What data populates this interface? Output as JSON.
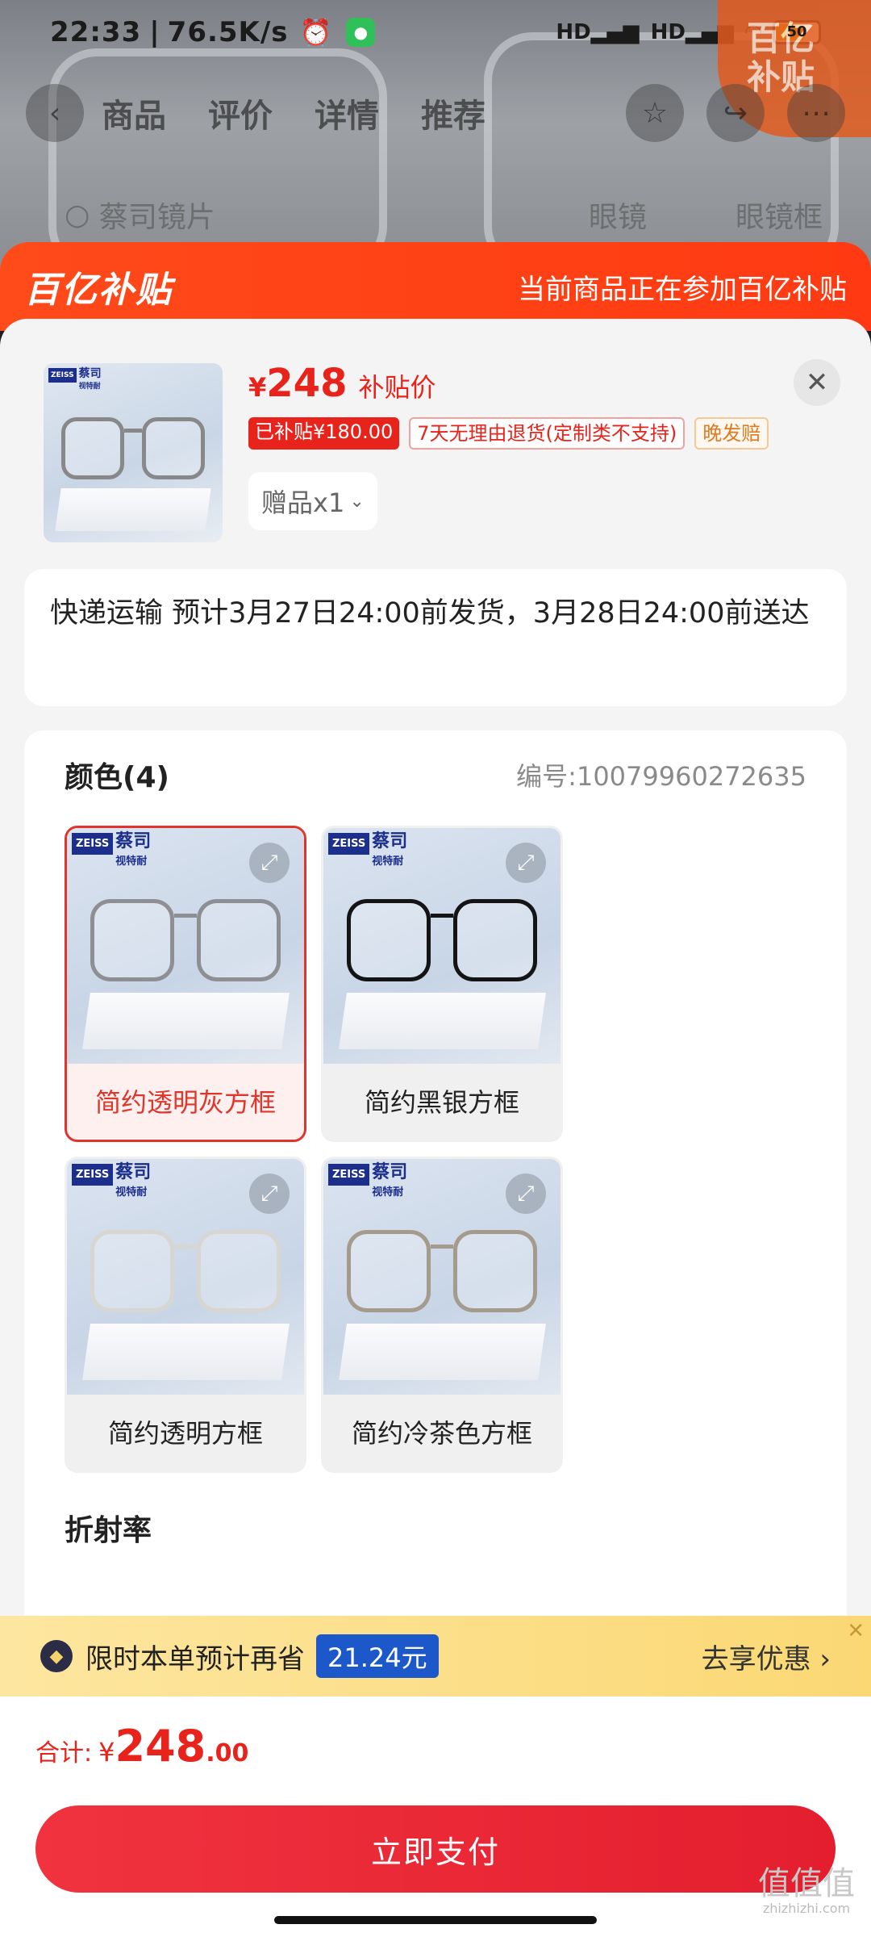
{
  "status_bar": {
    "time": "22:33",
    "speed": "76.5K/s",
    "hd1": "HD",
    "hd2": "HD",
    "battery": "50"
  },
  "product_nav": {
    "tabs": [
      "商品",
      "评价",
      "详情",
      "推荐"
    ],
    "search": "蔡司镜片",
    "sub_tabs": [
      "眼镜",
      "眼镜框"
    ]
  },
  "corner_badge": {
    "line1": "百亿",
    "line2": "补贴"
  },
  "banner": {
    "logo": "百亿补贴",
    "message": "当前商品正在参加百亿补贴"
  },
  "product": {
    "currency": "¥",
    "price": "248",
    "price_label": "补贴价",
    "tags": [
      "已补贴¥180.00",
      "7天无理由退货(定制类不支持)",
      "晚发赔"
    ],
    "gift": "赠品x1",
    "brand_badge": "ZEISS",
    "brand_text": "蔡司",
    "brand_sub": "视特耐"
  },
  "shipping": {
    "text": "快递运输 预计3月27日24:00前发货，3月28日24:00前送达"
  },
  "variants": {
    "title": "颜色(4)",
    "code": "编号:10079960272635",
    "options": [
      {
        "label": "简约透明灰方框",
        "selected": true,
        "frame_color": "#8d8f93"
      },
      {
        "label": "简约黑银方框",
        "selected": false,
        "frame_color": "#141414"
      },
      {
        "label": "简约透明方框",
        "selected": false,
        "frame_color": "#d8d6d2"
      },
      {
        "label": "简约冷茶色方框",
        "selected": false,
        "frame_color": "#a59b8d"
      }
    ],
    "next_section": "折射率"
  },
  "promo": {
    "text": "限时本单预计再省",
    "amount": "21.24元",
    "action": "去享优惠"
  },
  "footer": {
    "total_label": "合计:",
    "currency": "¥",
    "total_int": "248",
    "total_dec": ".00",
    "pay_label": "立即支付"
  },
  "watermark": {
    "text": "值值值",
    "url": "zhizhizhi.com"
  },
  "colors": {
    "accent": "#e8231b",
    "banner": "#ff4a1a",
    "promo_bg": "#fbd874",
    "pay": "#e41e2e"
  }
}
